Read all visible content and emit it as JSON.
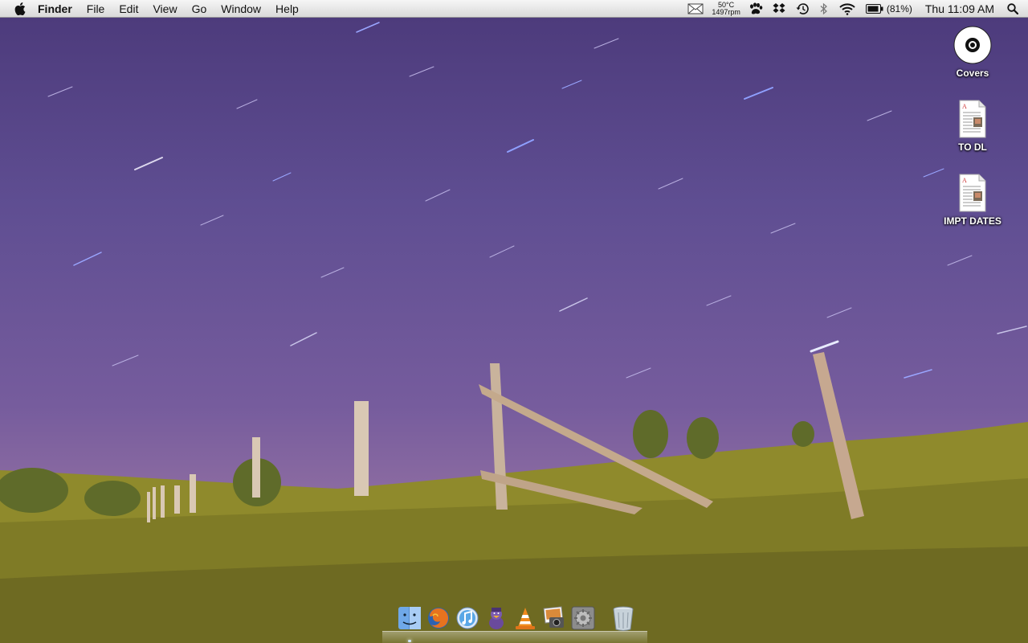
{
  "menubar": {
    "app_name": "Finder",
    "menus": [
      "File",
      "Edit",
      "View",
      "Go",
      "Window",
      "Help"
    ],
    "status": {
      "temperature": "50°C",
      "fan_speed": "1497rpm",
      "battery_percent": "(81%)",
      "clock": "Thu 11:09 AM"
    }
  },
  "desktop_icons": [
    {
      "label": "Covers",
      "icon": "disc-icon"
    },
    {
      "label": "TO DL",
      "icon": "document-icon"
    },
    {
      "label": "IMPT DATES",
      "icon": "document-icon"
    }
  ],
  "dock": {
    "apps": [
      {
        "name": "finder",
        "icon": "finder-icon"
      },
      {
        "name": "firefox",
        "icon": "firefox-icon"
      },
      {
        "name": "itunes",
        "icon": "itunes-icon"
      },
      {
        "name": "adium",
        "icon": "adium-duck-icon"
      },
      {
        "name": "vlc",
        "icon": "vlc-cone-icon"
      },
      {
        "name": "preview",
        "icon": "preview-icon"
      },
      {
        "name": "system-preferences",
        "icon": "system-preferences-icon"
      },
      {
        "name": "trash",
        "icon": "trash-icon"
      }
    ]
  },
  "colors": {
    "sky_top": "#4d3b7c",
    "sky_horizon": "#8a6aa1",
    "grass": "#8f8a2c",
    "menubar": "#e8e8e8"
  }
}
